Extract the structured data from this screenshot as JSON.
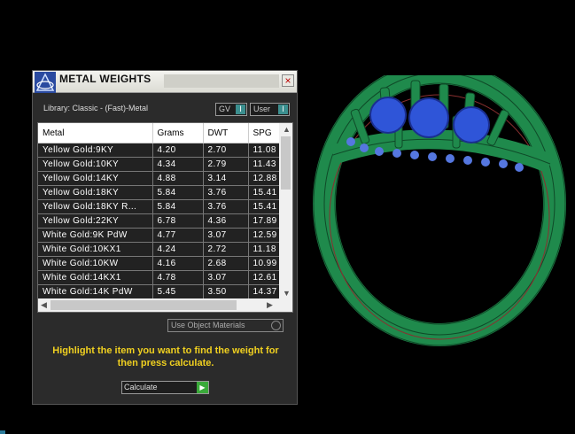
{
  "panel": {
    "title": "METAL WEIGHTS",
    "close_glyph": "×",
    "library_label": "Library: Classic - (Fast)-Metal",
    "toggle_gv": "GV",
    "toggle_user": "User",
    "toggle_knob": "I"
  },
  "table": {
    "columns": [
      "Metal",
      "Grams",
      "DWT",
      "SPG"
    ],
    "rows": [
      [
        "Yellow Gold:9KY",
        "4.20",
        "2.70",
        "11.08"
      ],
      [
        "Yellow Gold:10KY",
        "4.34",
        "2.79",
        "11.43"
      ],
      [
        "Yellow Gold:14KY",
        "4.88",
        "3.14",
        "12.88"
      ],
      [
        "Yellow Gold:18KY",
        "5.84",
        "3.76",
        "15.41"
      ],
      [
        "Yellow Gold:18KY R...",
        "5.84",
        "3.76",
        "15.41"
      ],
      [
        "Yellow Gold:22KY",
        "6.78",
        "4.36",
        "17.89"
      ],
      [
        "White Gold:9K PdW",
        "4.77",
        "3.07",
        "12.59"
      ],
      [
        "White Gold:10KX1",
        "4.24",
        "2.72",
        "11.18"
      ],
      [
        "White Gold:10KW",
        "4.16",
        "2.68",
        "10.99"
      ],
      [
        "White Gold:14KX1",
        "4.78",
        "3.07",
        "12.61"
      ],
      [
        "White Gold:14K PdW",
        "5.45",
        "3.50",
        "14.37"
      ]
    ]
  },
  "scroll": {
    "up": "▲",
    "down": "▼",
    "left": "◀",
    "right": "▶"
  },
  "use_object_materials": "Use Object Materials",
  "hint": "Highlight the item you want to find the weight for then press calculate.",
  "calculate": {
    "label": "Calculate",
    "go": "▶"
  },
  "colors": {
    "ring_metal": "#1f8a4c",
    "gems": "#2f55d8",
    "hint_text": "#f0d020"
  },
  "icons": {
    "logo": "matrix-logo-icon",
    "close": "close-icon"
  }
}
